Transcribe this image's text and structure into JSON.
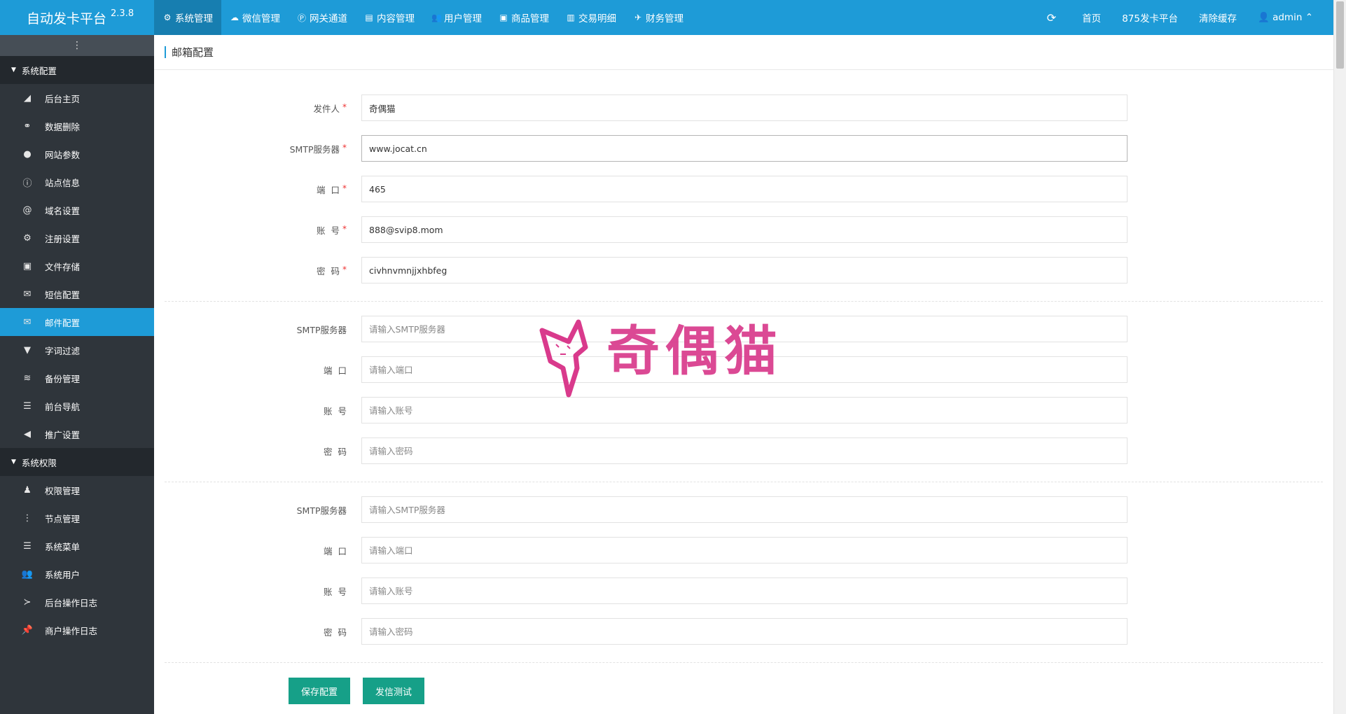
{
  "app": {
    "title": "自动发卡平台",
    "version": "2.3.8"
  },
  "topnav": [
    {
      "label": "系统管理",
      "icon": "gear-icon",
      "glyph": "⚙",
      "active": true
    },
    {
      "label": "微信管理",
      "icon": "wechat-icon",
      "glyph": "☁",
      "active": false
    },
    {
      "label": "网关通道",
      "icon": "paypal-icon",
      "glyph": "Ⓟ",
      "active": false
    },
    {
      "label": "内容管理",
      "icon": "file-icon",
      "glyph": "▤",
      "active": false
    },
    {
      "label": "用户管理",
      "icon": "users-icon",
      "glyph": "👥",
      "active": false
    },
    {
      "label": "商品管理",
      "icon": "shopping-bag-icon",
      "glyph": "▣",
      "active": false
    },
    {
      "label": "交易明细",
      "icon": "bar-chart-icon",
      "glyph": "▥",
      "active": false
    },
    {
      "label": "财务管理",
      "icon": "bullhorn-icon",
      "glyph": "✈",
      "active": false
    }
  ],
  "topright": {
    "refresh_icon": "refresh-icon",
    "home": "首页",
    "platform": "875发卡平台",
    "clear_cache": "清除缓存",
    "user": "admin"
  },
  "sidebar": {
    "groups": [
      {
        "label": "系统配置",
        "items": [
          {
            "label": "后台主页",
            "icon": "area-chart-icon",
            "glyph": "◢"
          },
          {
            "label": "数据删除",
            "icon": "link-icon",
            "glyph": "⚭"
          },
          {
            "label": "网站参数",
            "icon": "apple-icon",
            "glyph": "●"
          },
          {
            "label": "站点信息",
            "icon": "info-circle-icon",
            "glyph": "ⓘ"
          },
          {
            "label": "域名设置",
            "icon": "at-icon",
            "glyph": "@"
          },
          {
            "label": "注册设置",
            "icon": "cog-icon",
            "glyph": "⚙"
          },
          {
            "label": "文件存储",
            "icon": "floppy-icon",
            "glyph": "▣"
          },
          {
            "label": "短信配置",
            "icon": "envelope-icon",
            "glyph": "✉"
          },
          {
            "label": "邮件配置",
            "icon": "envelope-icon",
            "glyph": "✉",
            "active": true
          },
          {
            "label": "字词过滤",
            "icon": "filter-icon",
            "glyph": "▼"
          },
          {
            "label": "备份管理",
            "icon": "database-icon",
            "glyph": "≋"
          },
          {
            "label": "前台导航",
            "icon": "bars-icon",
            "glyph": "☰"
          },
          {
            "label": "推广设置",
            "icon": "bullhorn-icon",
            "glyph": "◀"
          }
        ]
      },
      {
        "label": "系统权限",
        "items": [
          {
            "label": "权限管理",
            "icon": "user-secret-icon",
            "glyph": "♟"
          },
          {
            "label": "节点管理",
            "icon": "ellipsis-vertical-icon",
            "glyph": "⋮"
          },
          {
            "label": "系统菜单",
            "icon": "list-icon",
            "glyph": "☰"
          },
          {
            "label": "系统用户",
            "icon": "users-icon",
            "glyph": "👥"
          },
          {
            "label": "后台操作日志",
            "icon": "terminal-icon",
            "glyph": "≻"
          },
          {
            "label": "商户操作日志",
            "icon": "thumb-tack-icon",
            "glyph": "📌"
          }
        ]
      }
    ]
  },
  "page": {
    "title": "邮箱配置"
  },
  "form": {
    "primary": {
      "sender": {
        "label": "发件人",
        "value": "奇偶猫"
      },
      "smtp": {
        "label": "SMTP服务器",
        "value": "www.jocat.cn"
      },
      "port": {
        "label": "端  口",
        "value": "465"
      },
      "account": {
        "label": "账  号",
        "value": "888@svip8.mom"
      },
      "password": {
        "label": "密  码",
        "value": "civhnvmnjjxhbfeg"
      }
    },
    "backup1": {
      "smtp": {
        "label": "SMTP服务器",
        "placeholder": "请输入SMTP服务器"
      },
      "port": {
        "label": "端  口",
        "placeholder": "请输入端口"
      },
      "account": {
        "label": "账  号",
        "placeholder": "请输入账号"
      },
      "password": {
        "label": "密  码",
        "placeholder": "请输入密码"
      }
    },
    "backup2": {
      "smtp": {
        "label": "SMTP服务器",
        "placeholder": "请输入SMTP服务器"
      },
      "port": {
        "label": "端  口",
        "placeholder": "请输入端口"
      },
      "account": {
        "label": "账  号",
        "placeholder": "请输入账号"
      },
      "password": {
        "label": "密  码",
        "placeholder": "请输入密码"
      }
    },
    "buttons": {
      "save": "保存配置",
      "test": "发信测试"
    }
  },
  "watermark": {
    "text": "奇偶猫"
  },
  "colors": {
    "topbar": "#1e9bd7",
    "sidebar": "#2f353b",
    "accent": "#1e9bd7",
    "button": "#16a088",
    "watermark": "#d93a8c"
  }
}
